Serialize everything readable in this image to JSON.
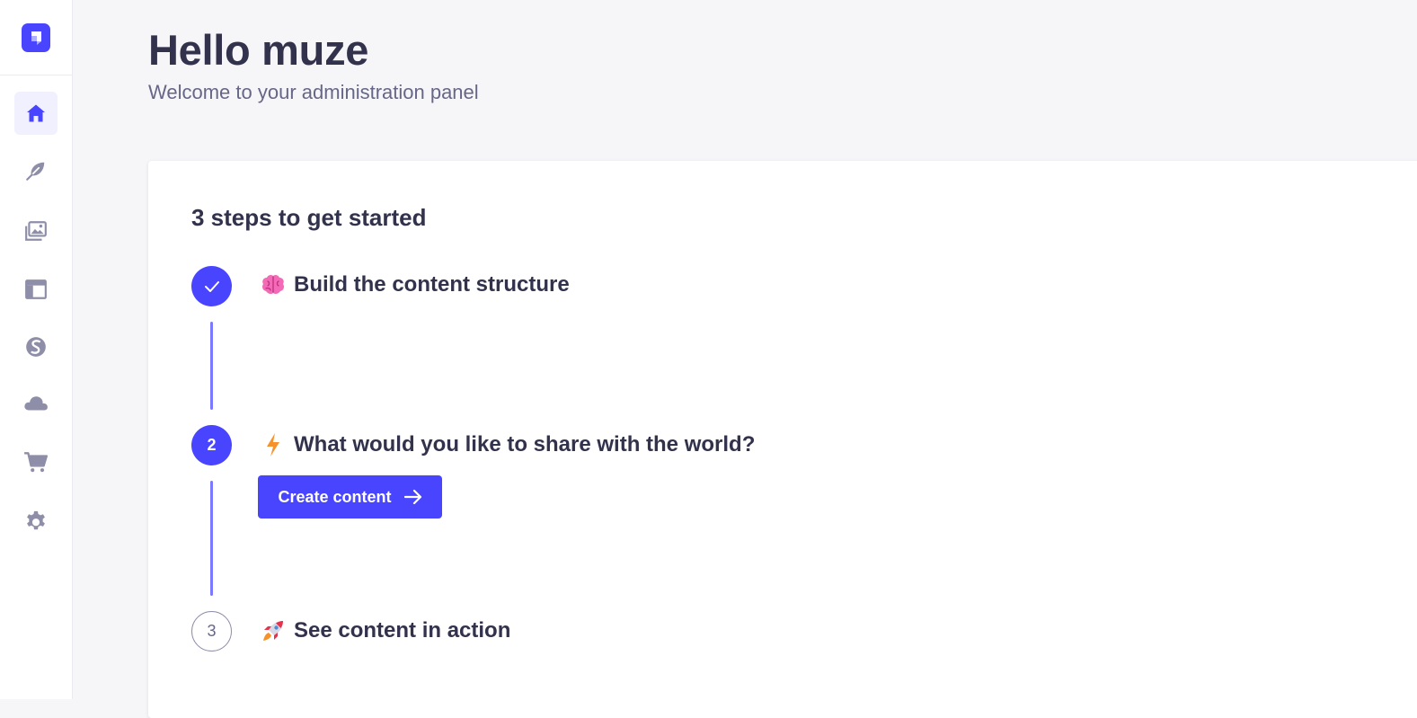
{
  "sidebar": {
    "logo_icon": "strapi-logo-icon",
    "items": [
      {
        "id": "home",
        "icon": "home-icon",
        "active": true
      },
      {
        "id": "content-manager",
        "icon": "feather-icon",
        "active": false
      },
      {
        "id": "media-library",
        "icon": "images-icon",
        "active": false
      },
      {
        "id": "content-type-builder",
        "icon": "layout-icon",
        "active": false
      },
      {
        "id": "plugin",
        "icon": "brand-s-icon",
        "active": false
      },
      {
        "id": "cloud",
        "icon": "cloud-icon",
        "active": false
      },
      {
        "id": "marketplace",
        "icon": "cart-icon",
        "active": false
      },
      {
        "id": "settings",
        "icon": "gear-icon",
        "active": false
      }
    ]
  },
  "header": {
    "title": "Hello muze",
    "subtitle": "Welcome to your administration panel"
  },
  "guide": {
    "title": "3 steps to get started",
    "steps": [
      {
        "status": "done",
        "number": "",
        "emoji": "brain-icon",
        "label": "Build the content structure"
      },
      {
        "status": "current",
        "number": "2",
        "emoji": "lightning-icon",
        "label": "What would you like to share with the world?",
        "button_label": "Create content"
      },
      {
        "status": "todo",
        "number": "3",
        "emoji": "rocket-icon",
        "label": "See content in action"
      }
    ]
  },
  "colors": {
    "primary": "#4945ff",
    "line": "#7b79ff",
    "text": "#32324d",
    "muted": "#666687",
    "background": "#f6f6f9"
  }
}
